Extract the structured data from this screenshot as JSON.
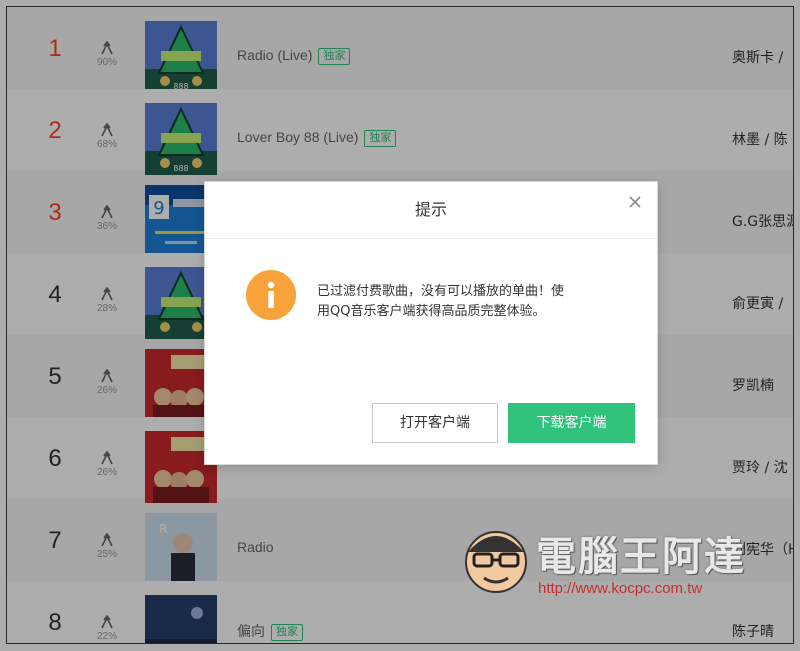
{
  "chart": {
    "rows": [
      {
        "rank": "1",
        "pct": "90%",
        "title": "Radio (Live)",
        "badge": "独家",
        "singer": "奥斯卡 /"
      },
      {
        "rank": "2",
        "pct": "68%",
        "title": "Lover Boy 88 (Live)",
        "badge": "独家",
        "singer": "林墨 / 陈"
      },
      {
        "rank": "3",
        "pct": "36%",
        "title": "",
        "badge": "",
        "singer": "G.G张思源"
      },
      {
        "rank": "4",
        "pct": "28%",
        "title": "",
        "badge": "",
        "singer": "俞更寅 /"
      },
      {
        "rank": "5",
        "pct": "26%",
        "title": "",
        "badge": "",
        "singer": "罗凯楠"
      },
      {
        "rank": "6",
        "pct": "26%",
        "title": "",
        "badge": "",
        "singer": "贾玲 / 沈"
      },
      {
        "rank": "7",
        "pct": "25%",
        "title": "Radio",
        "badge": "",
        "singer": "刘宪华（H"
      },
      {
        "rank": "8",
        "pct": "22%",
        "title": "偏向",
        "badge": "独家",
        "singer": "陈子晴"
      }
    ]
  },
  "dialog": {
    "title": "提示",
    "message": "已过滤付费歌曲，没有可以播放的单曲！使用QQ音乐客户端获得高品质完整体验。",
    "open_button": "打开客户端",
    "download_button": "下载客户端",
    "close_icon": "close-icon",
    "info_icon": "info-icon"
  },
  "watermark": {
    "brand": "電腦王阿達",
    "url": "http://www.kocpc.com.tw"
  },
  "colors": {
    "accent_green": "#31c27c",
    "rank_hot_red": "#ff4222",
    "info_orange": "#f7a23b"
  }
}
